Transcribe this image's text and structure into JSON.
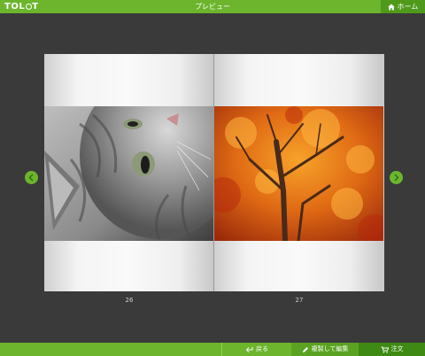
{
  "header": {
    "logo_text": "TOLOT",
    "title": "プレビュー",
    "home_label": "ホーム"
  },
  "book": {
    "left_page_number": "26",
    "right_page_number": "27",
    "left_photo": "gray tabby cat looking up",
    "right_photo": "orange autumn maple tree"
  },
  "footer": {
    "back_label": "戻る",
    "edit_label": "複製して編集",
    "order_label": "注文"
  },
  "colors": {
    "accent": "#6cb52d",
    "background": "#3a3a3a"
  }
}
